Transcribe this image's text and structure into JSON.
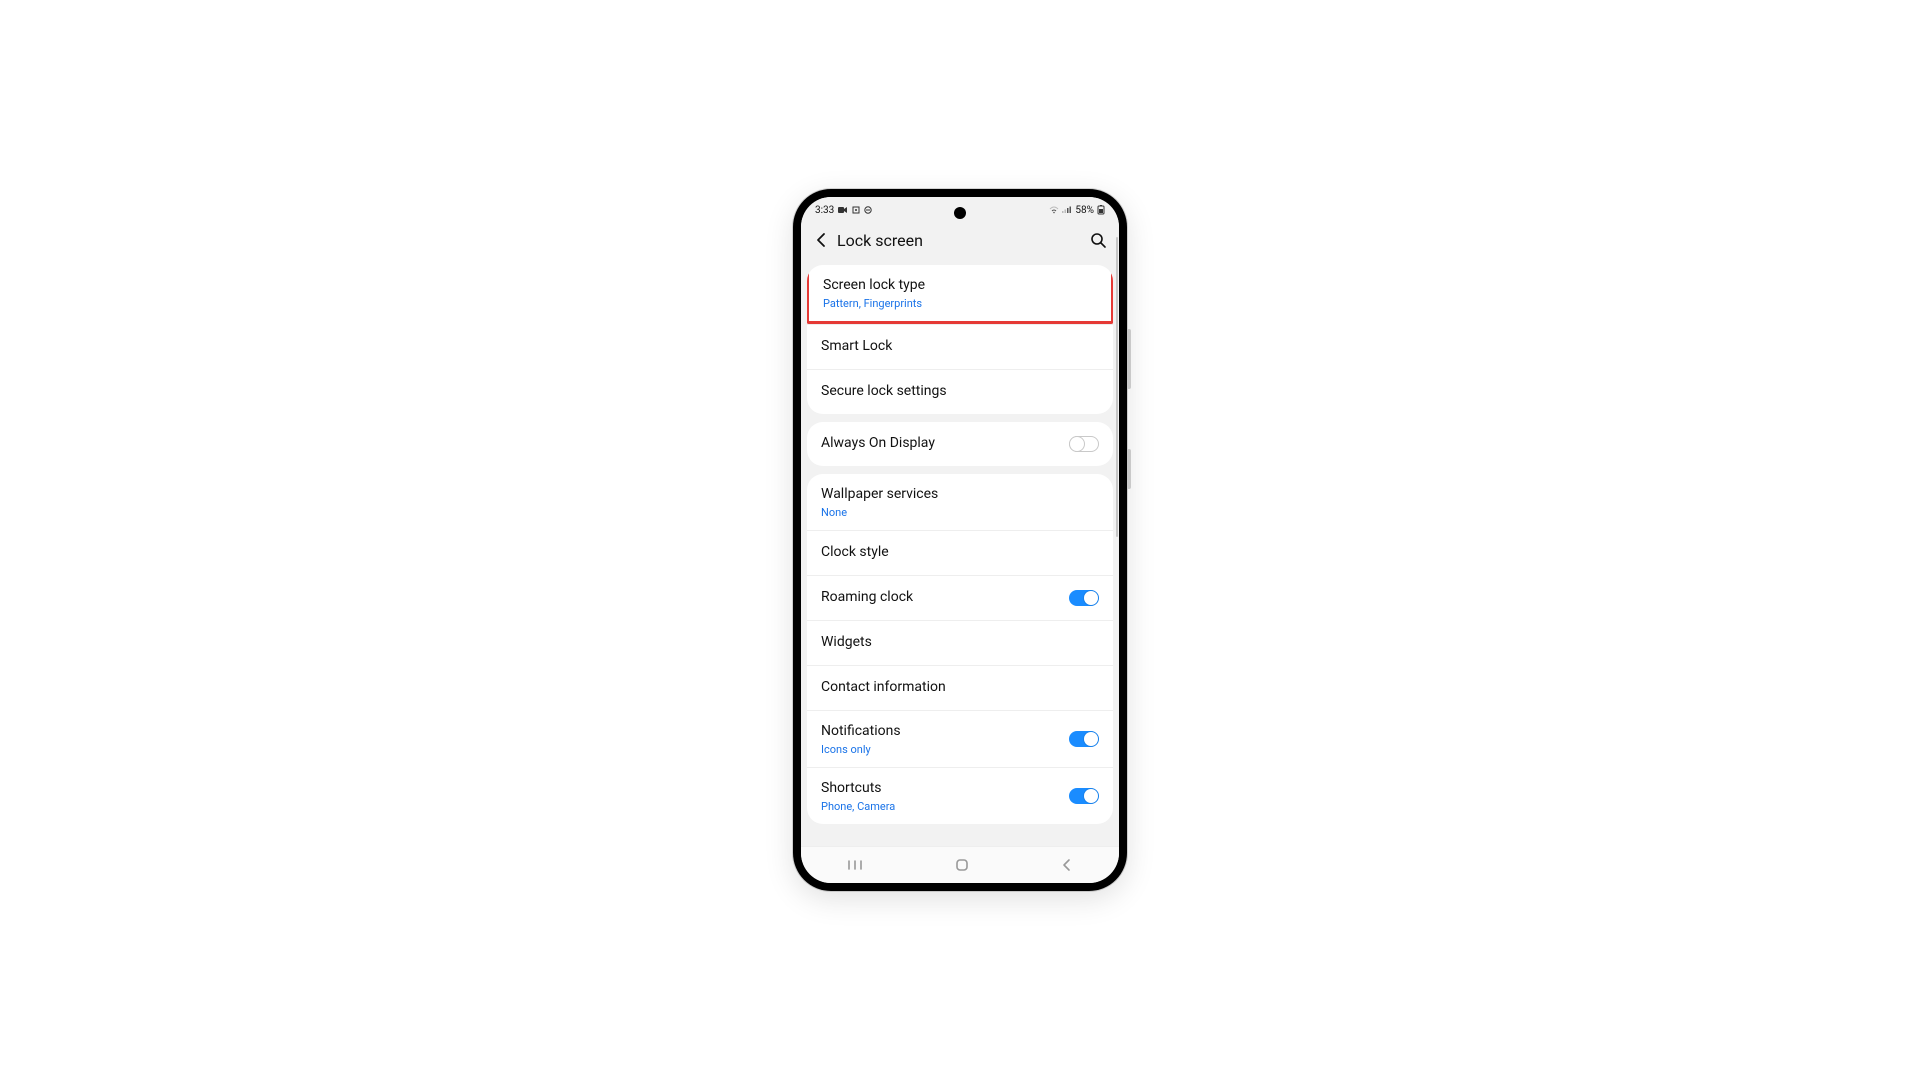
{
  "status": {
    "time": "3:33",
    "battery_text": "58%"
  },
  "appbar": {
    "title": "Lock screen"
  },
  "groups": [
    {
      "rows": [
        {
          "title": "Screen lock type",
          "sub": "Pattern, Fingerprints",
          "highlight": true
        },
        {
          "title": "Smart Lock"
        },
        {
          "title": "Secure lock settings"
        }
      ]
    },
    {
      "rows": [
        {
          "title": "Always On Display",
          "toggle": "off"
        }
      ]
    },
    {
      "rows": [
        {
          "title": "Wallpaper services",
          "sub": "None"
        },
        {
          "title": "Clock style"
        },
        {
          "title": "Roaming clock",
          "toggle": "on"
        },
        {
          "title": "Widgets"
        },
        {
          "title": "Contact information"
        },
        {
          "title": "Notifications",
          "sub": "Icons only",
          "toggle": "on"
        },
        {
          "title": "Shortcuts",
          "sub": "Phone, Camera",
          "toggle": "on"
        }
      ]
    }
  ]
}
